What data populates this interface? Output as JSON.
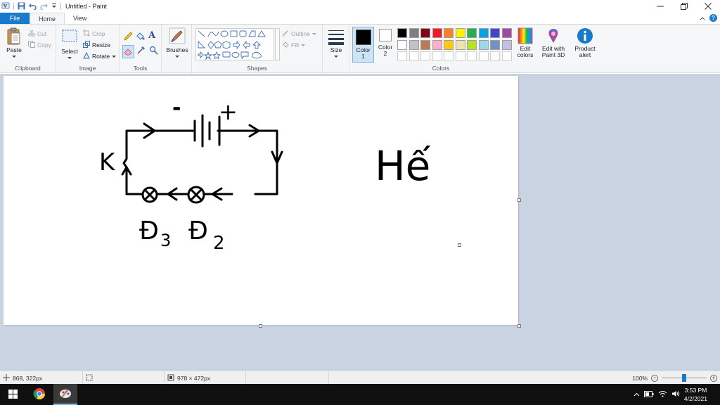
{
  "window": {
    "title": "Untitled - Paint"
  },
  "tabs": [
    {
      "label": "File"
    },
    {
      "label": "Home"
    },
    {
      "label": "View"
    }
  ],
  "ribbon": {
    "clipboard": {
      "paste_label": "Paste",
      "cut_label": "Cut",
      "copy_label": "Copy",
      "group_label": "Clipboard"
    },
    "image": {
      "select_label": "Select",
      "crop_label": "Crop",
      "resize_label": "Resize",
      "rotate_label": "Rotate",
      "group_label": "Image"
    },
    "tools": {
      "group_label": "Tools"
    },
    "brushes": {
      "label": "Brushes"
    },
    "shapes": {
      "outline_label": "Outline",
      "fill_label": "Fill",
      "group_label": "Shapes"
    },
    "size": {
      "label": "Size"
    },
    "colors": {
      "color1_label": "Color",
      "color1_num": "1",
      "color2_label": "Color",
      "color2_num": "2",
      "color1_value": "#000000",
      "color2_value": "#ffffff",
      "edit_colors_line1": "Edit",
      "edit_colors_line2": "colors",
      "group_label": "Colors",
      "palette_row1": [
        "#000000",
        "#7f7f7f",
        "#880015",
        "#ed1c24",
        "#ff7f27",
        "#fff200",
        "#22b14c",
        "#00a2e8",
        "#3f48cc",
        "#a349a4"
      ],
      "palette_row2": [
        "#ffffff",
        "#c3c3c3",
        "#b97a57",
        "#ffaec9",
        "#ffc90e",
        "#efe4b0",
        "#b5e61d",
        "#99d9ea",
        "#7092be",
        "#c8bfe7"
      ]
    },
    "paint3d": {
      "line1": "Edit with",
      "line2": "Paint 3D"
    },
    "product_alert": {
      "line1": "Product",
      "line2": "alert"
    }
  },
  "canvas": {
    "drawing_text": {
      "k": "K",
      "minus": "-",
      "plus": "+",
      "d3_letter": "Đ",
      "d3_sub": "3",
      "d2_letter": "Đ",
      "d2_sub": "2",
      "he": "Hế"
    }
  },
  "statusbar": {
    "cursor_pos": "868, 322px",
    "canvas_size": "978 × 472px",
    "zoom_level": "100%",
    "zoom_percent": 100
  },
  "taskbar": {
    "time": "3:53 PM",
    "date": "4/2/2021"
  }
}
